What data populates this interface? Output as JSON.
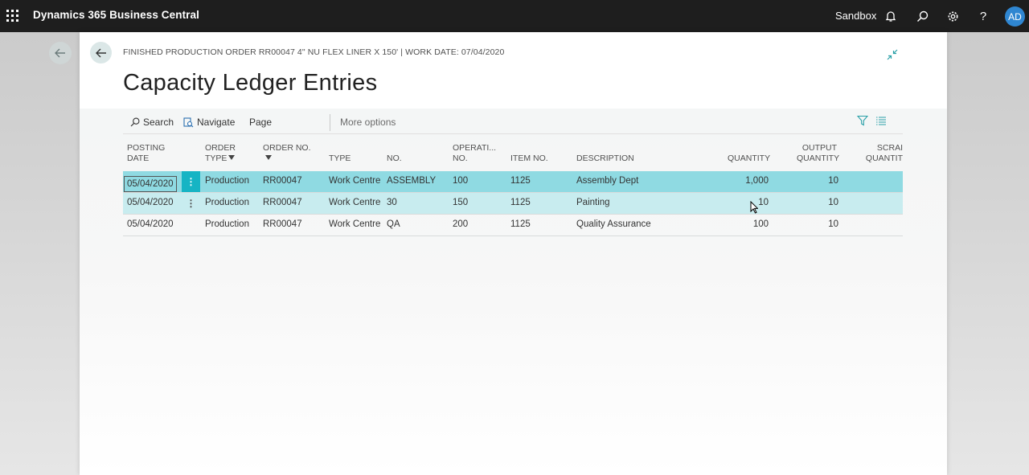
{
  "topbar": {
    "app_title": "Dynamics 365 Business Central",
    "environment": "Sandbox",
    "avatar_initials": "AD",
    "icons": [
      "waffle-icon",
      "bell-icon",
      "search-icon",
      "gear-icon",
      "help-icon"
    ]
  },
  "page": {
    "breadcrumb": "FINISHED PRODUCTION ORDER RR00047 4\" NU FLEX LINER X 150' | WORK DATE: 07/04/2020",
    "title": "Capacity Ledger Entries"
  },
  "actions": {
    "search": "Search",
    "navigate": "Navigate",
    "page": "Page",
    "more_options": "More options"
  },
  "columns": {
    "posting_date": [
      "POSTING",
      "DATE"
    ],
    "order_type": [
      "ORDER",
      "TYPE"
    ],
    "order_no": [
      "ORDER NO.",
      ""
    ],
    "type": "TYPE",
    "no": "NO.",
    "operation_no": [
      "OPERATI...",
      "NO."
    ],
    "item_no": "ITEM NO.",
    "description": "DESCRIPTION",
    "quantity": "QUANTITY",
    "output_quantity": [
      "OUTPUT",
      "QUANTITY"
    ],
    "scrap_quantity": [
      "SCRAI",
      "QUANTIT"
    ]
  },
  "rows": [
    {
      "posting_date": "05/04/2020",
      "order_type": "Production",
      "order_no": "RR00047",
      "type": "Work Centre",
      "no": "ASSEMBLY",
      "operation_no": "100",
      "item_no": "1125",
      "description": "Assembly Dept",
      "quantity": "1,000",
      "output_quantity": "10"
    },
    {
      "posting_date": "05/04/2020",
      "order_type": "Production",
      "order_no": "RR00047",
      "type": "Work Centre",
      "no": "30",
      "operation_no": "150",
      "item_no": "1125",
      "description": "Painting",
      "quantity": "10",
      "output_quantity": "10"
    },
    {
      "posting_date": "05/04/2020",
      "order_type": "Production",
      "order_no": "RR00047",
      "type": "Work Centre",
      "no": "QA",
      "operation_no": "200",
      "item_no": "1125",
      "description": "Quality Assurance",
      "quantity": "100",
      "output_quantity": "10"
    }
  ],
  "colors": {
    "topbar": "#1e1e1e",
    "selected_row": "#8fdae2",
    "selected_row_handle": "#16b4c4",
    "hover_row": "#c8ecef",
    "avatar": "#2f86d1"
  }
}
